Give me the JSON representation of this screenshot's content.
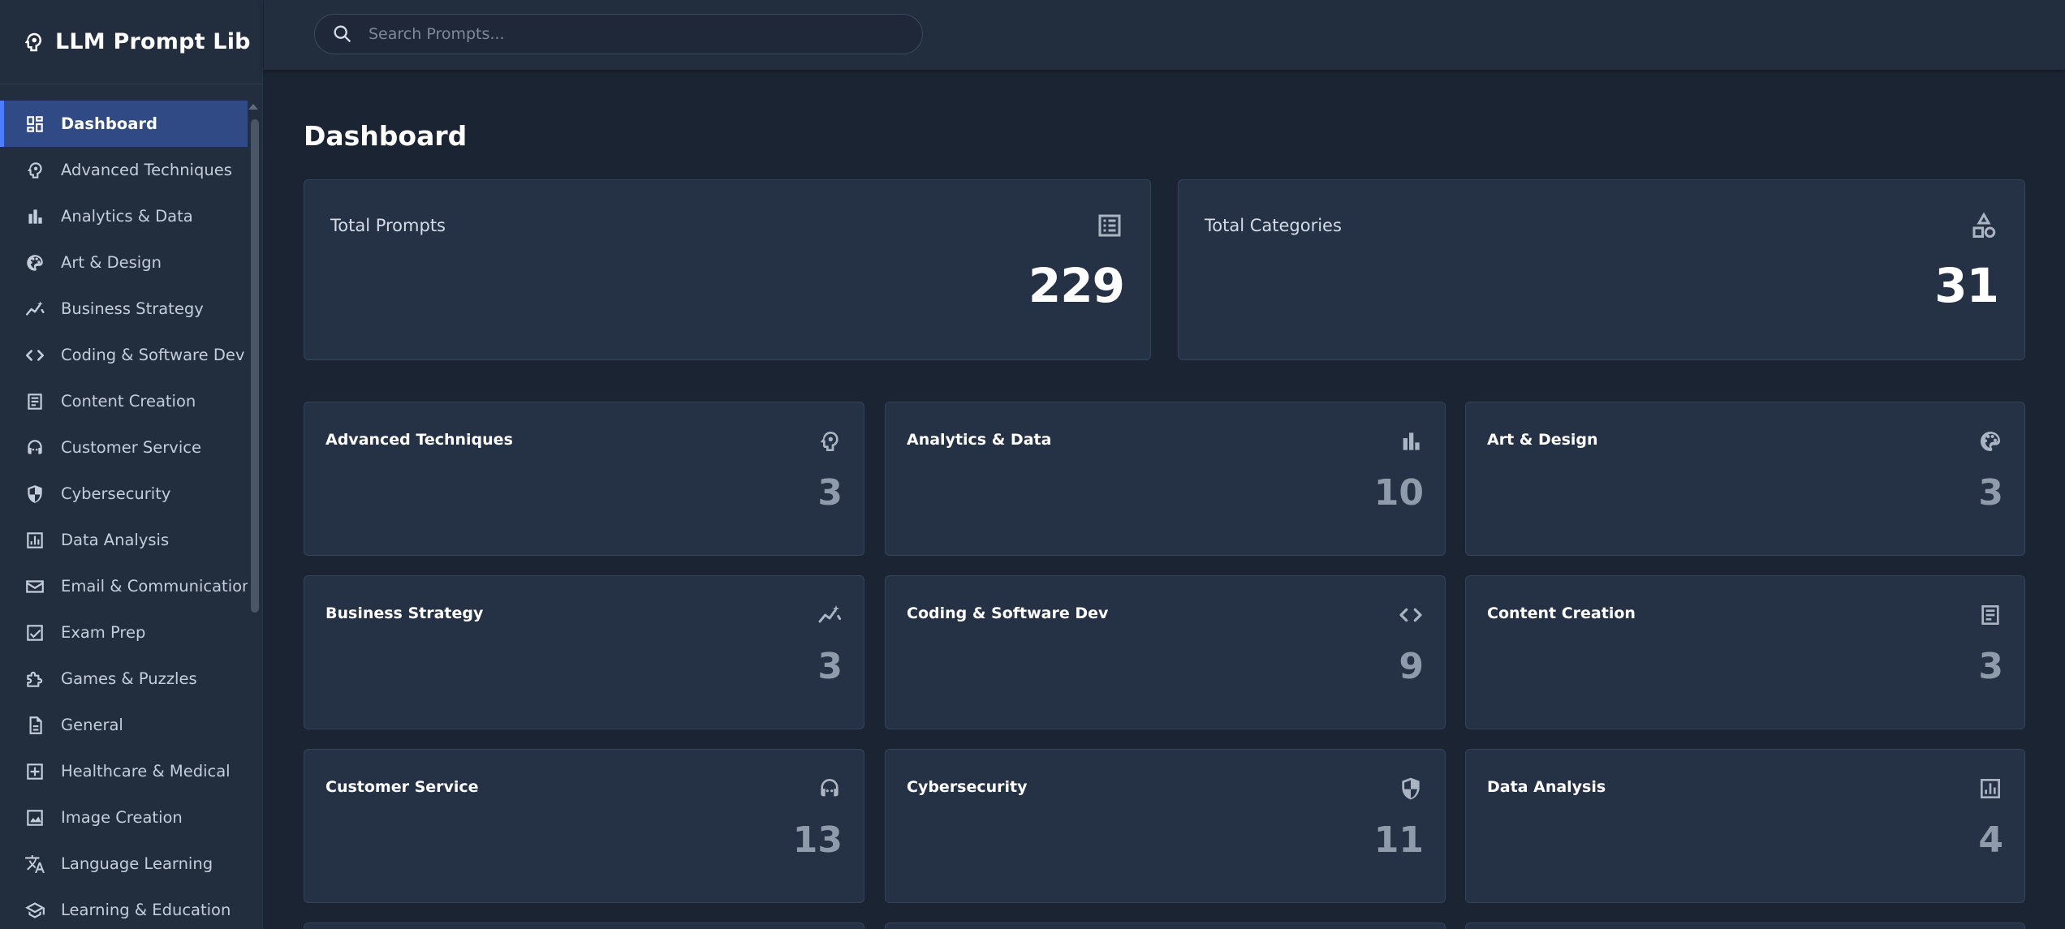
{
  "app": {
    "title": "LLM Prompt Lib"
  },
  "search": {
    "placeholder": "Search Prompts..."
  },
  "sidebar": {
    "items": [
      {
        "label": "Dashboard",
        "icon": "dashboard-icon",
        "active": true
      },
      {
        "label": "Advanced Techniques",
        "icon": "psychology-icon"
      },
      {
        "label": "Analytics & Data",
        "icon": "bar-chart-icon"
      },
      {
        "label": "Art & Design",
        "icon": "palette-icon"
      },
      {
        "label": "Business Strategy",
        "icon": "trend-sparkle-icon"
      },
      {
        "label": "Coding & Software Dev",
        "icon": "code-icon"
      },
      {
        "label": "Content Creation",
        "icon": "article-icon"
      },
      {
        "label": "Customer Service",
        "icon": "headset-icon"
      },
      {
        "label": "Cybersecurity",
        "icon": "shield-icon"
      },
      {
        "label": "Data Analysis",
        "icon": "analytics-icon"
      },
      {
        "label": "Email & Communication",
        "icon": "mail-icon"
      },
      {
        "label": "Exam Prep",
        "icon": "checkbox-icon"
      },
      {
        "label": "Games & Puzzles",
        "icon": "puzzle-icon"
      },
      {
        "label": "General",
        "icon": "document-icon"
      },
      {
        "label": "Healthcare & Medical",
        "icon": "medical-icon"
      },
      {
        "label": "Image Creation",
        "icon": "image-icon"
      },
      {
        "label": "Language Learning",
        "icon": "translate-icon"
      },
      {
        "label": "Learning & Education",
        "icon": "school-icon"
      }
    ]
  },
  "main": {
    "title": "Dashboard",
    "stats": [
      {
        "label": "Total Prompts",
        "value": "229",
        "icon": "list-icon"
      },
      {
        "label": "Total Categories",
        "value": "31",
        "icon": "category-icon"
      }
    ],
    "categories": [
      {
        "label": "Advanced Techniques",
        "count": "3",
        "icon": "psychology-icon"
      },
      {
        "label": "Analytics & Data",
        "count": "10",
        "icon": "bar-chart-icon"
      },
      {
        "label": "Art & Design",
        "count": "3",
        "icon": "palette-icon"
      },
      {
        "label": "Business Strategy",
        "count": "3",
        "icon": "trend-sparkle-icon"
      },
      {
        "label": "Coding & Software Dev",
        "count": "9",
        "icon": "code-icon"
      },
      {
        "label": "Content Creation",
        "count": "3",
        "icon": "article-icon"
      },
      {
        "label": "Customer Service",
        "count": "13",
        "icon": "headset-icon"
      },
      {
        "label": "Cybersecurity",
        "count": "11",
        "icon": "shield-icon"
      },
      {
        "label": "Data Analysis",
        "count": "4",
        "icon": "analytics-icon"
      }
    ]
  },
  "colors": {
    "background": "#1b2433",
    "sidebar": "#222d3e",
    "card": "#253246",
    "active_item": "#2f4a84",
    "accent": "#4d7cff"
  }
}
